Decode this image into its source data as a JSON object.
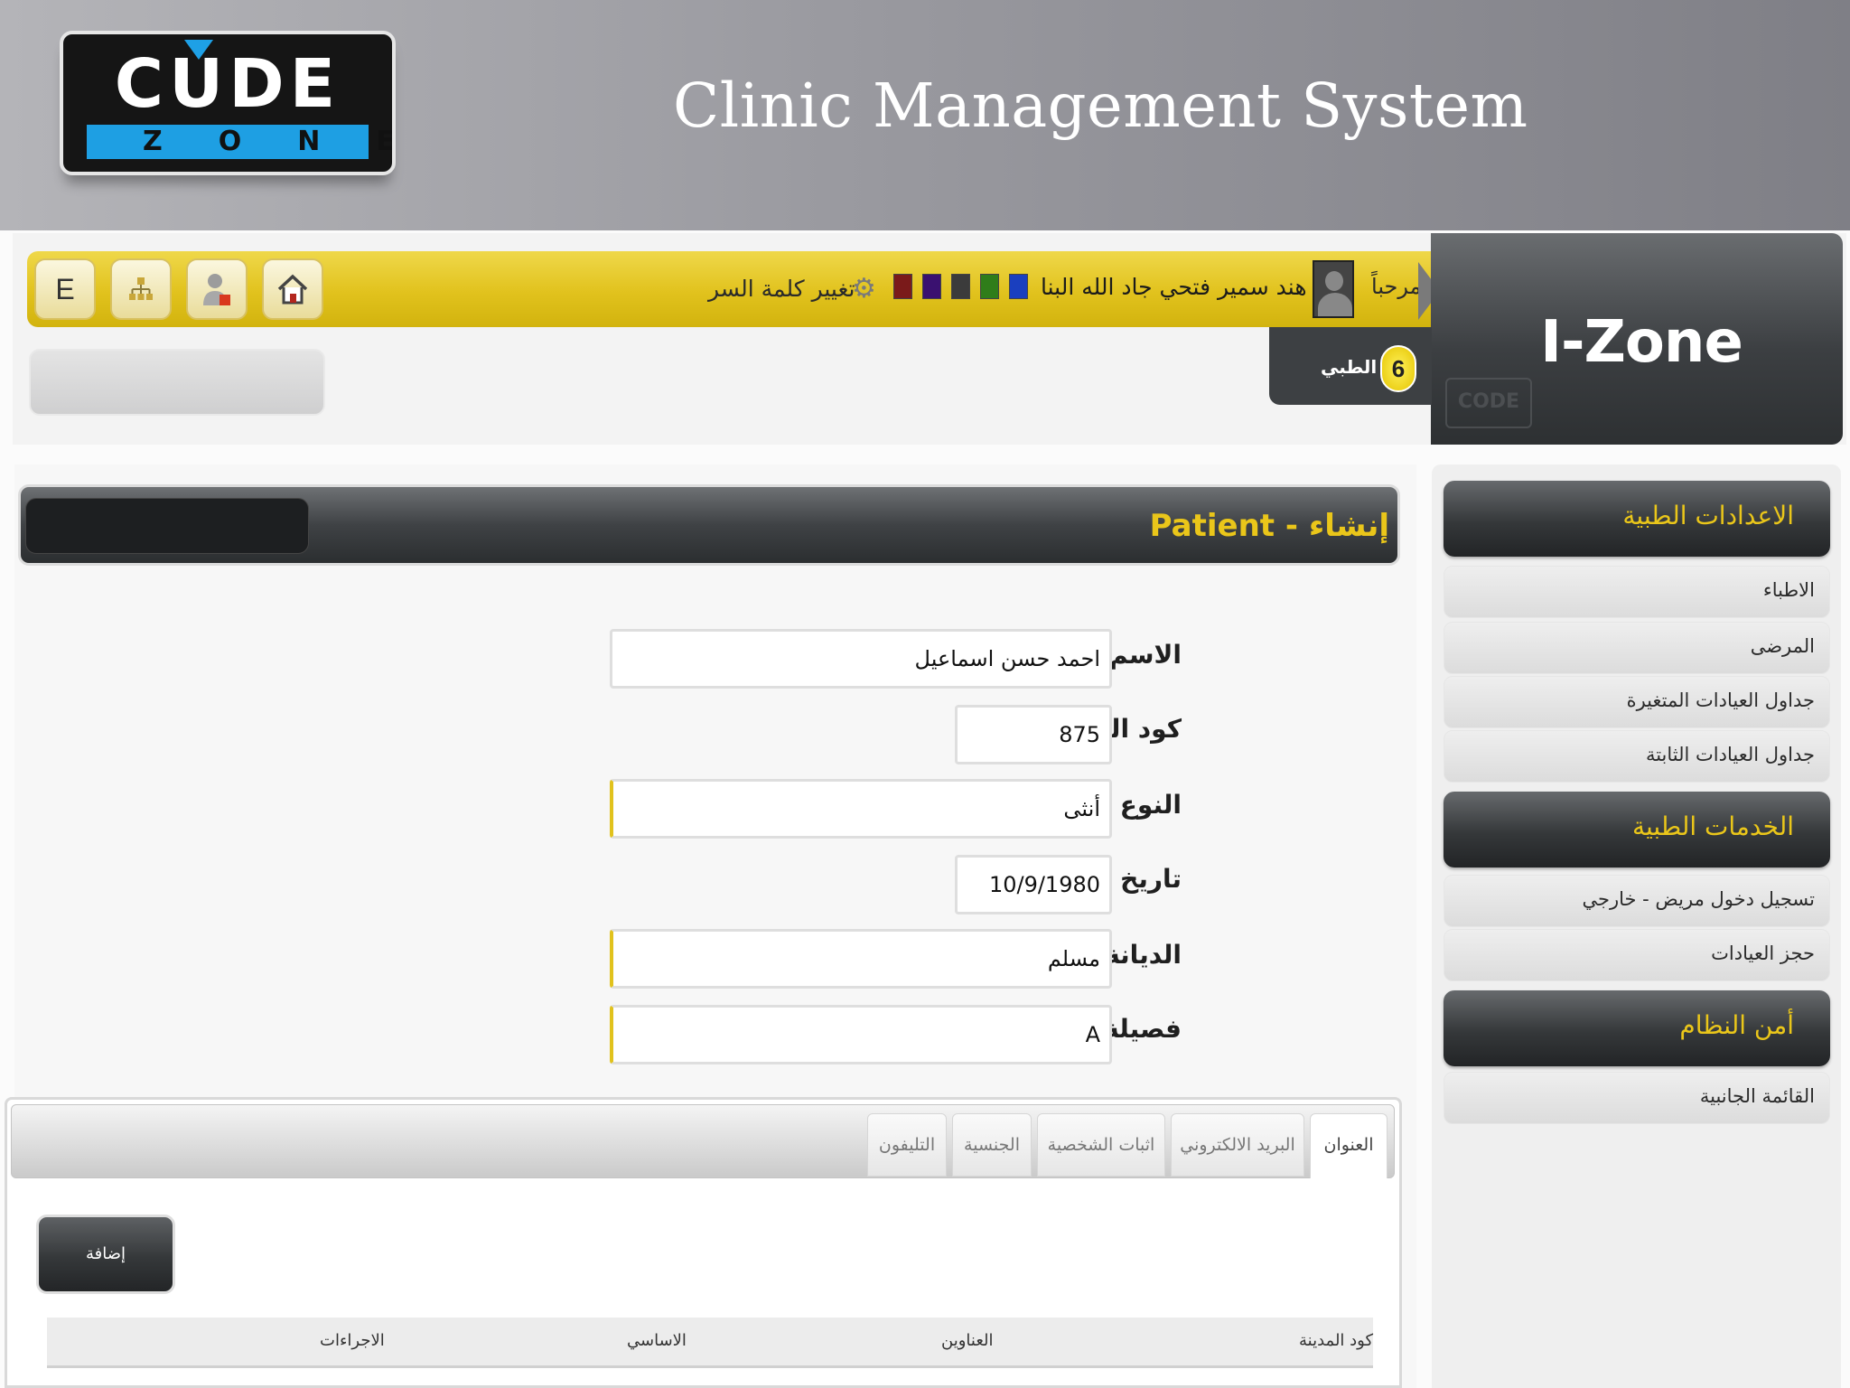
{
  "slide": {
    "logo_top": "CUDE",
    "logo_bottom": "ZONE",
    "title": "Clinic Management System"
  },
  "topbar": {
    "welcome": "مرحباً",
    "user_name": "هند سمير فتحي جاد الله البنا",
    "change_password": "تغيير كلمة السر",
    "buttons": {
      "e_label": "E"
    },
    "theme_colors": [
      "#7a1a1a",
      "#3a1170",
      "#3b3b3b",
      "#2f7d1a",
      "#1a3fbf"
    ],
    "brand": "I-Zone",
    "brand_mark": "CODE",
    "notification": {
      "count": "6",
      "label": "الطبي"
    }
  },
  "sidebar": {
    "sections": [
      {
        "title": "الاعدادات الطبية",
        "items": [
          "الاطباء",
          "المرضى",
          "جداول العيادات المتغيرة",
          "جداول العيادات الثابتة"
        ]
      },
      {
        "title": "الخدمات الطبية",
        "items": [
          "تسجيل دخول مريض - خارجي",
          "حجز العيادات"
        ]
      },
      {
        "title": "أمن النظام",
        "items": [
          "القائمة الجانبية"
        ]
      }
    ]
  },
  "main": {
    "title": "Patient - إنشاء",
    "fields": {
      "name": {
        "label": "الاسم",
        "value": "احمد حسن اسماعيل"
      },
      "code": {
        "label": "كود المريض",
        "value": "875"
      },
      "gender": {
        "label": "النوع",
        "value": "أنثى"
      },
      "dob": {
        "label": "تاريخ الميلاد",
        "value": "10/9/1980"
      },
      "religion": {
        "label": "الديانة",
        "value": "مسلم"
      },
      "blood": {
        "label": "فصيلة الدم",
        "value": "A"
      }
    },
    "tabs": [
      "العنوان",
      "البريد الالكتروني",
      "اثبات الشخصية",
      "الجنسية",
      "التليفون"
    ],
    "add_button": "إضافة",
    "columns": [
      "كود المدينة",
      "العناوين",
      "الاساسي",
      "الاجراءات"
    ]
  }
}
